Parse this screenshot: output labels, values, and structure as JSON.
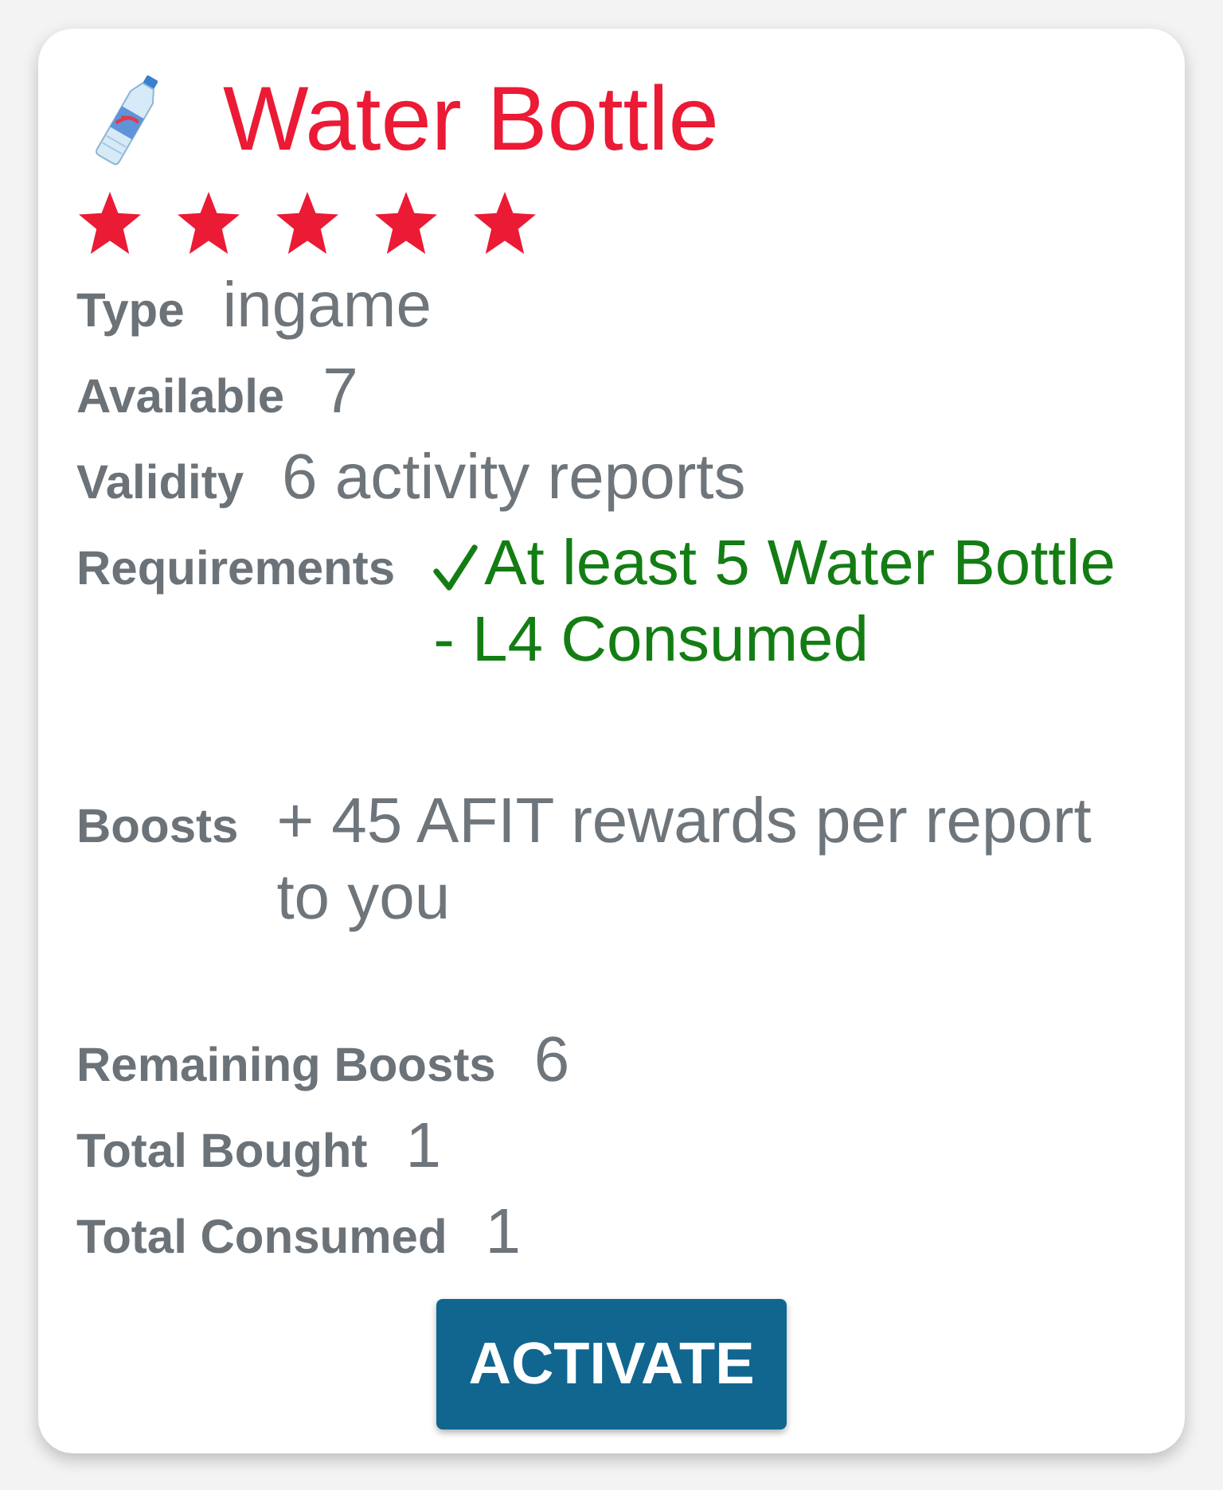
{
  "card": {
    "title": "Water Bottle",
    "stars": 5,
    "details": [
      {
        "label": "Type",
        "value": "ingame"
      },
      {
        "label": "Available",
        "value": "7"
      },
      {
        "label": "Validity",
        "value": "6 activity reports"
      }
    ],
    "requirements": {
      "label": "Requirements",
      "items": [
        {
          "text": "At least 5 Water Bottle - L4 Consumed",
          "met": true
        }
      ]
    },
    "boosts": {
      "label": "Boosts",
      "text": "+ 45 AFIT rewards per report to you"
    },
    "totals": [
      {
        "label": "Remaining Boosts",
        "value": "6"
      },
      {
        "label": "Total Bought",
        "value": "1"
      },
      {
        "label": "Total Consumed",
        "value": "1"
      }
    ],
    "button": "ACTIVATE"
  }
}
